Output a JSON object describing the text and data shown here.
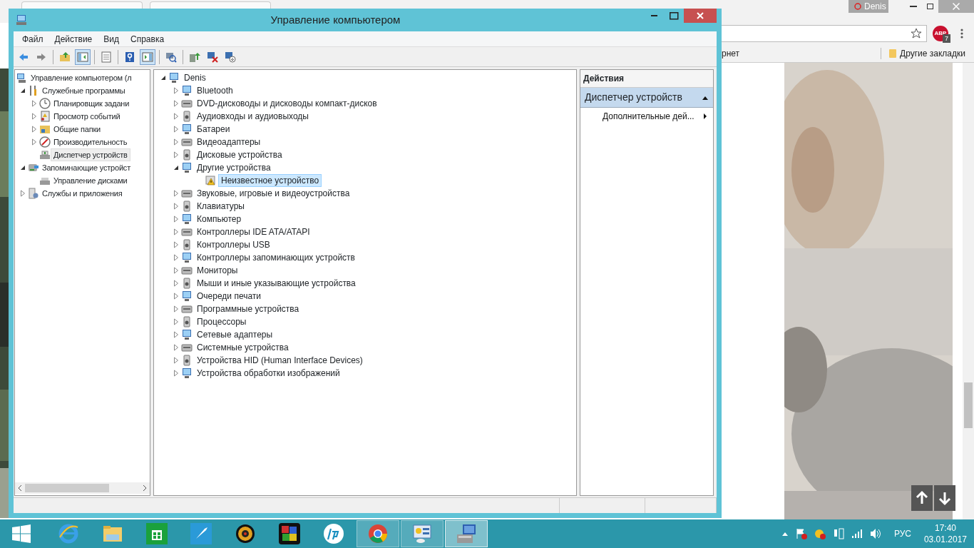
{
  "browser": {
    "user": "Denis",
    "extension": {
      "label": "ABP",
      "count": "7"
    },
    "bookmarks": [
      {
        "label": "рнет",
        "kind": "link"
      },
      {
        "label": "Другие закладки",
        "kind": "folder"
      }
    ]
  },
  "window": {
    "title": "Управление компьютером"
  },
  "menu": [
    "Файл",
    "Действие",
    "Вид",
    "Справка"
  ],
  "toolbar": [
    {
      "kind": "back",
      "pressed": false
    },
    {
      "kind": "forward",
      "pressed": false
    },
    {
      "kind": "sep"
    },
    {
      "kind": "up",
      "pressed": false
    },
    {
      "kind": "tree",
      "pressed": true
    },
    {
      "kind": "sep"
    },
    {
      "kind": "props",
      "pressed": false
    },
    {
      "kind": "sep"
    },
    {
      "kind": "help",
      "pressed": false
    },
    {
      "kind": "pane",
      "pressed": true
    },
    {
      "kind": "sep"
    },
    {
      "kind": "scan",
      "pressed": false
    },
    {
      "kind": "sep"
    },
    {
      "kind": "update",
      "pressed": false
    },
    {
      "kind": "remove",
      "pressed": false
    },
    {
      "kind": "disable",
      "pressed": false
    }
  ],
  "nav_tree": [
    {
      "label": "Управление компьютером (л",
      "selected": false,
      "children": [
        {
          "label": "Служебные программы",
          "expanded": true,
          "selected": false,
          "children": [
            {
              "label": "Планировщик задани",
              "expanded": false,
              "selected": false
            },
            {
              "label": "Просмотр событий",
              "expanded": false,
              "selected": false
            },
            {
              "label": "Общие папки",
              "expanded": false,
              "selected": false
            },
            {
              "label": "Производительность",
              "expanded": false,
              "selected": false
            },
            {
              "label": "Диспетчер устройств",
              "selected": true
            }
          ]
        },
        {
          "label": "Запоминающие устройст",
          "expanded": true,
          "selected": false,
          "children": [
            {
              "label": "Управление дисками",
              "selected": false
            }
          ]
        },
        {
          "label": "Службы и приложения",
          "expanded": false,
          "selected": false
        }
      ]
    }
  ],
  "device_tree": [
    {
      "label": "Denis",
      "expanded": true,
      "selected": false,
      "children": [
        {
          "label": "Bluetooth",
          "expanded": false,
          "selected": false
        },
        {
          "label": "DVD-дисководы и дисководы компакт-дисков",
          "expanded": false,
          "selected": false
        },
        {
          "label": "Аудиовходы и аудиовыходы",
          "expanded": false,
          "selected": false
        },
        {
          "label": "Батареи",
          "expanded": false,
          "selected": false
        },
        {
          "label": "Видеоадаптеры",
          "expanded": false,
          "selected": false
        },
        {
          "label": "Дисковые устройства",
          "expanded": false,
          "selected": false
        },
        {
          "label": "Другие устройства",
          "expanded": true,
          "selected": false,
          "children": [
            {
              "label": "Неизвестное устройство",
              "selected": true,
              "warning": true
            }
          ]
        },
        {
          "label": "Звуковые, игровые и видеоустройства",
          "expanded": false,
          "selected": false
        },
        {
          "label": "Клавиатуры",
          "expanded": false,
          "selected": false
        },
        {
          "label": "Компьютер",
          "expanded": false,
          "selected": false
        },
        {
          "label": "Контроллеры IDE ATA/ATAPI",
          "expanded": false,
          "selected": false
        },
        {
          "label": "Контроллеры USB",
          "expanded": false,
          "selected": false
        },
        {
          "label": "Контроллеры запоминающих устройств",
          "expanded": false,
          "selected": false
        },
        {
          "label": "Мониторы",
          "expanded": false,
          "selected": false
        },
        {
          "label": "Мыши и иные указывающие устройства",
          "expanded": false,
          "selected": false
        },
        {
          "label": "Очереди печати",
          "expanded": false,
          "selected": false
        },
        {
          "label": "Программные устройства",
          "expanded": false,
          "selected": false
        },
        {
          "label": "Процессоры",
          "expanded": false,
          "selected": false
        },
        {
          "label": "Сетевые адаптеры",
          "expanded": false,
          "selected": false
        },
        {
          "label": "Системные устройства",
          "expanded": false,
          "selected": false
        },
        {
          "label": "Устройства HID (Human Interface Devices)",
          "expanded": false,
          "selected": false
        },
        {
          "label": "Устройства обработки изображений",
          "expanded": false,
          "selected": false
        }
      ]
    }
  ],
  "actions": {
    "header": "Действия",
    "section": {
      "label": "Диспетчер устройств",
      "expanded": true
    },
    "items": [
      {
        "label": "Дополнительные дей...",
        "submenu": true
      }
    ]
  },
  "taskbar": {
    "apps": [
      {
        "kind": "ie",
        "running": false,
        "selected": false
      },
      {
        "kind": "explorer",
        "running": false,
        "selected": false
      },
      {
        "kind": "store",
        "running": false,
        "selected": false
      },
      {
        "kind": "rocket",
        "running": false,
        "selected": false
      },
      {
        "kind": "webcam",
        "running": false,
        "selected": false
      },
      {
        "kind": "puzzle",
        "running": false,
        "selected": false
      },
      {
        "kind": "hp",
        "running": false,
        "selected": false
      },
      {
        "kind": "chrome",
        "running": true,
        "selected": false
      },
      {
        "kind": "panel",
        "running": true,
        "selected": false
      },
      {
        "kind": "mmc",
        "running": true,
        "selected": true
      }
    ],
    "tray": {
      "language": "РУС",
      "time": "17:40",
      "date": "03.01.2017"
    }
  }
}
